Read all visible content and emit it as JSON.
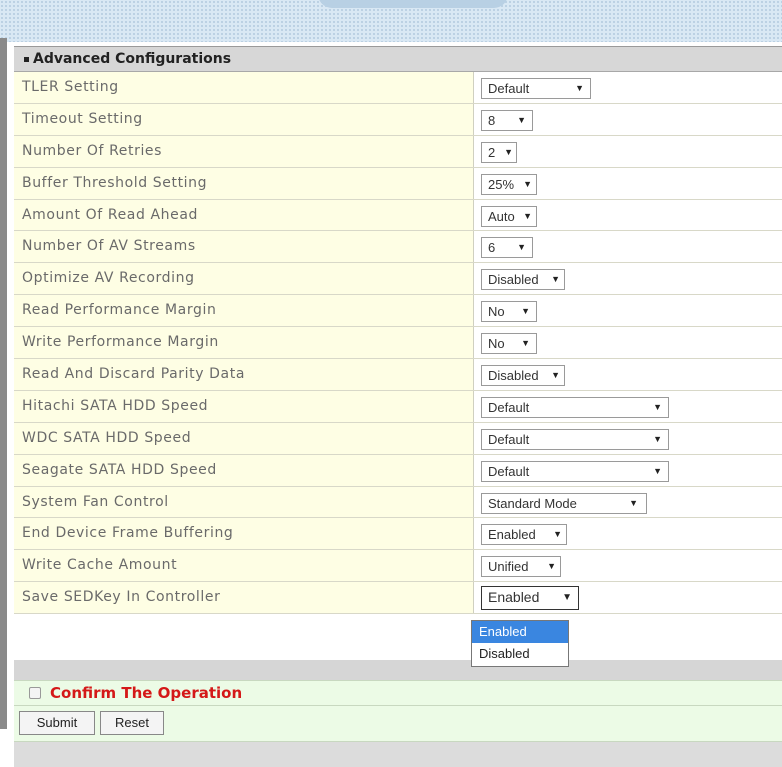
{
  "section": {
    "title": "Advanced Configurations"
  },
  "rows": [
    {
      "label": "TLER Setting",
      "value": "Default"
    },
    {
      "label": "Timeout Setting",
      "value": "8"
    },
    {
      "label": "Number Of Retries",
      "value": "2"
    },
    {
      "label": "Buffer Threshold Setting",
      "value": "25%"
    },
    {
      "label": "Amount Of Read Ahead",
      "value": "Auto"
    },
    {
      "label": "Number Of AV Streams",
      "value": "6"
    },
    {
      "label": "Optimize AV Recording",
      "value": "Disabled"
    },
    {
      "label": "Read Performance Margin",
      "value": "No"
    },
    {
      "label": "Write Performance Margin",
      "value": "No"
    },
    {
      "label": "Read And Discard Parity Data",
      "value": "Disabled"
    },
    {
      "label": "Hitachi SATA HDD Speed",
      "value": "Default"
    },
    {
      "label": "WDC SATA HDD Speed",
      "value": "Default"
    },
    {
      "label": "Seagate SATA HDD Speed",
      "value": "Default"
    },
    {
      "label": "System Fan Control",
      "value": "Standard Mode"
    },
    {
      "label": "End Device Frame Buffering",
      "value": "Enabled"
    },
    {
      "label": "Write Cache Amount",
      "value": "Unified"
    },
    {
      "label": "Save SEDKey In Controller",
      "value": "Enabled"
    }
  ],
  "dropdown": {
    "options": [
      "Enabled",
      "Disabled"
    ],
    "highlighted": "Enabled"
  },
  "confirm": {
    "label": "Confirm The Operation"
  },
  "buttons": {
    "submit": "Submit",
    "reset": "Reset"
  },
  "icons": {
    "select_arrow": "triangle-down-icon",
    "bullet": "square-bullet-icon"
  },
  "colors": {
    "label_bg": "#fefee4",
    "confirm_bg": "#ecfbe6",
    "confirm_text": "#d41818",
    "highlight": "#3a86e0"
  }
}
